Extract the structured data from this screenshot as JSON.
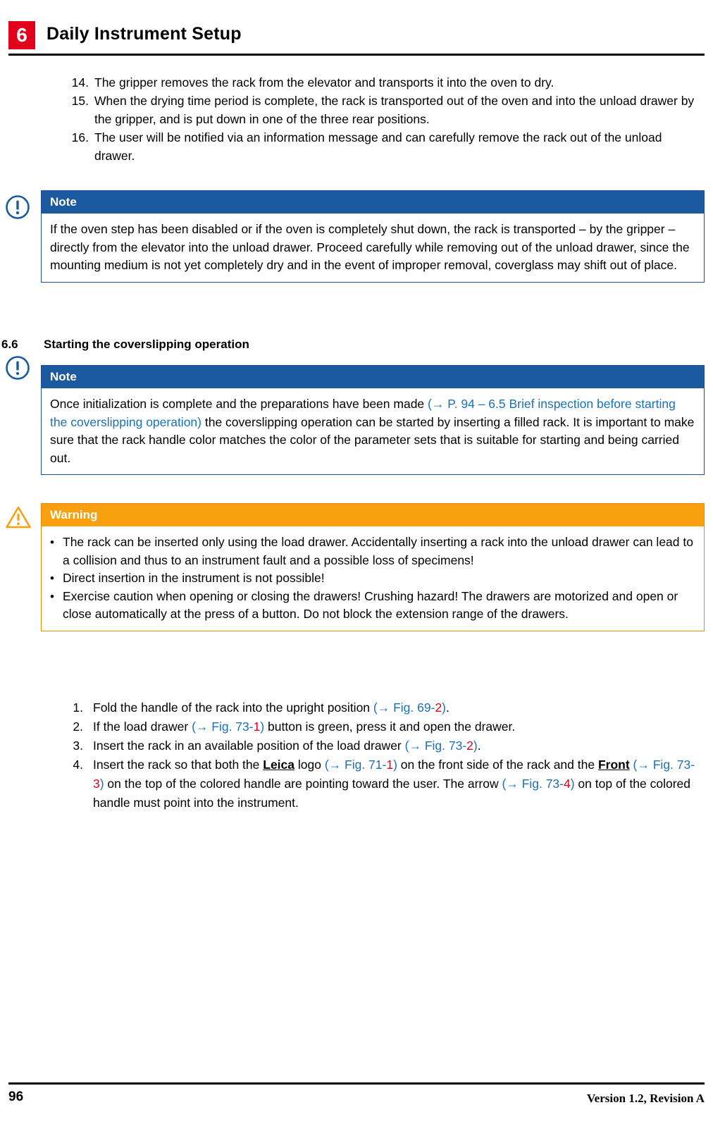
{
  "header": {
    "chapter_number": "6",
    "title": "Daily Instrument Setup"
  },
  "top_list": {
    "items": [
      {
        "num": "14.",
        "text": "The gripper removes the rack from the elevator and transports it into the oven to dry."
      },
      {
        "num": "15.",
        "text": "When the drying time period is complete, the rack is transported out of the oven and into the unload drawer by the gripper, and is put down in one of the three rear positions."
      },
      {
        "num": "16.",
        "text": "The user will be notified via an information message and can carefully remove the rack out of the unload drawer."
      }
    ]
  },
  "note_one": {
    "label": "Note",
    "body": "If the oven step has been disabled or if the oven is completely shut down, the rack is transported – by the gripper – directly from the elevator into the unload drawer. Proceed carefully while removing out of the unload drawer, since the mounting medium is not yet completely dry and in the event of improper removal, coverglass may shift out of place."
  },
  "section": {
    "number": "6.6",
    "title": "Starting the coverslipping operation"
  },
  "note_two": {
    "label": "Note",
    "text_1": "Once initialization is complete and the preparations have been made ",
    "xref_1": "(→ P. 94 – 6.5 Brief inspection before starting the coverslipping operation)",
    "text_2": " the coverslipping operation can be started by inserting a filled rack. It is important to make sure that the rack handle color matches the color of the parameter sets that is suitable for starting and being carried out."
  },
  "warning": {
    "label": "Warning",
    "bullets": [
      "The rack can be inserted only using the load drawer. Accidentally inserting a rack into the unload drawer can lead to a collision and thus to an instrument fault and a possible loss of specimens!",
      "Direct insertion in the instrument is not possible!",
      "Exercise caution when opening or closing the drawers! Crushing hazard! The drawers are motorized and open or close automatically at the press of a button. Do not block the extension range of the drawers."
    ]
  },
  "bottom_list": {
    "items": [
      {
        "num": "1.",
        "parts": [
          {
            "type": "text",
            "value": "Fold the handle of the rack into the upright position "
          },
          {
            "type": "xref",
            "value": "(→ Fig.  69-"
          },
          {
            "type": "xref_red",
            "value": "2"
          },
          {
            "type": "xref",
            "value": ")"
          },
          {
            "type": "text",
            "value": "."
          }
        ]
      },
      {
        "num": "2.",
        "parts": [
          {
            "type": "text",
            "value": "If the load drawer "
          },
          {
            "type": "xref",
            "value": "(→ Fig.  73-"
          },
          {
            "type": "xref_red",
            "value": "1"
          },
          {
            "type": "xref",
            "value": ")"
          },
          {
            "type": "text",
            "value": " button is green, press it and open the drawer."
          }
        ]
      },
      {
        "num": "3.",
        "parts": [
          {
            "type": "text",
            "value": "Insert the rack in an available position of the load drawer "
          },
          {
            "type": "xref",
            "value": "(→ Fig.  73-"
          },
          {
            "type": "xref_red",
            "value": "2"
          },
          {
            "type": "xref",
            "value": ")"
          },
          {
            "type": "text",
            "value": "."
          }
        ]
      },
      {
        "num": "4.",
        "parts": [
          {
            "type": "text",
            "value": "Insert the rack so that both the "
          },
          {
            "type": "bold_underline",
            "value": "Leica"
          },
          {
            "type": "text",
            "value": " logo "
          },
          {
            "type": "xref",
            "value": "(→ Fig.  71-"
          },
          {
            "type": "xref_red",
            "value": "1"
          },
          {
            "type": "xref",
            "value": ")"
          },
          {
            "type": "text",
            "value": " on the front side of the rack and the "
          },
          {
            "type": "bold_underline",
            "value": "Front"
          },
          {
            "type": "text",
            "value": " "
          },
          {
            "type": "xref",
            "value": "(→ Fig.  73-"
          },
          {
            "type": "xref_red",
            "value": "3"
          },
          {
            "type": "xref",
            "value": ")"
          },
          {
            "type": "text",
            "value": " on the top of the colored handle are pointing toward the user. The arrow "
          },
          {
            "type": "xref",
            "value": "(→ Fig.  73-"
          },
          {
            "type": "xref_red",
            "value": "4"
          },
          {
            "type": "xref",
            "value": ")"
          },
          {
            "type": "text",
            "value": " on top of the colored handle must point into the instrument."
          }
        ]
      }
    ]
  },
  "footer": {
    "page_number": "96",
    "version": "Version 1.2, Revision A"
  },
  "colors": {
    "chapter_badge": "#e2001a",
    "note_header": "#1b5a9e",
    "note_border": "#1b4f9c",
    "warning_header": "#f9a011",
    "warning_border": "#f18a00",
    "xref_link": "#1b70b8",
    "xref_number": "#e2001a"
  }
}
